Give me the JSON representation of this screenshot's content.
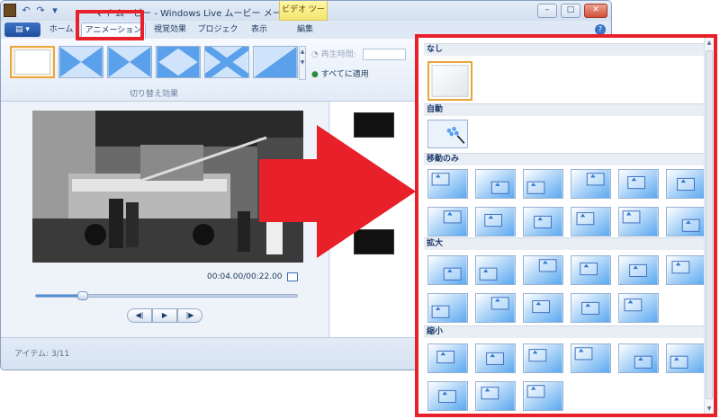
{
  "window": {
    "title": "マイ ムービー - Windows Live ムービー メーカー",
    "context_label": "ビデオ ツール",
    "controls": {
      "minimize": "–",
      "maximize": "□",
      "close": "✕"
    },
    "help": "?"
  },
  "quick_access": {
    "undo": "↶",
    "redo": "↷",
    "customize": "▾"
  },
  "tabs": {
    "file": "▤ ▾",
    "home": "ホーム",
    "animation": "アニメーション",
    "visual_effects": "視覚効果",
    "project": "プロジェクト",
    "view": "表示",
    "edit": "編集"
  },
  "ribbon": {
    "transitions_group_label": "切り替え効果",
    "duration_label": "再生時間:",
    "apply_all_label": "すべてに適用",
    "scroll_up": "▲",
    "scroll_down": "▼"
  },
  "preview": {
    "time": "00:04.00/00:22.00",
    "controls": {
      "prev": "◀|",
      "play": "▶",
      "next": "|▶"
    },
    "progress": 0.18
  },
  "status": {
    "items": "アイテム: 3/11"
  },
  "panel": {
    "sections": {
      "none": "なし",
      "auto": "自動",
      "move_only": "移動のみ",
      "zoom_in": "拡大",
      "zoom_out": "縮小"
    },
    "scroll_up": "▲",
    "scroll_down": "▼"
  },
  "colors": {
    "highlight": "#e8202a",
    "ribbon_selected": "#e9a53c",
    "accent": "#3c74c8"
  }
}
